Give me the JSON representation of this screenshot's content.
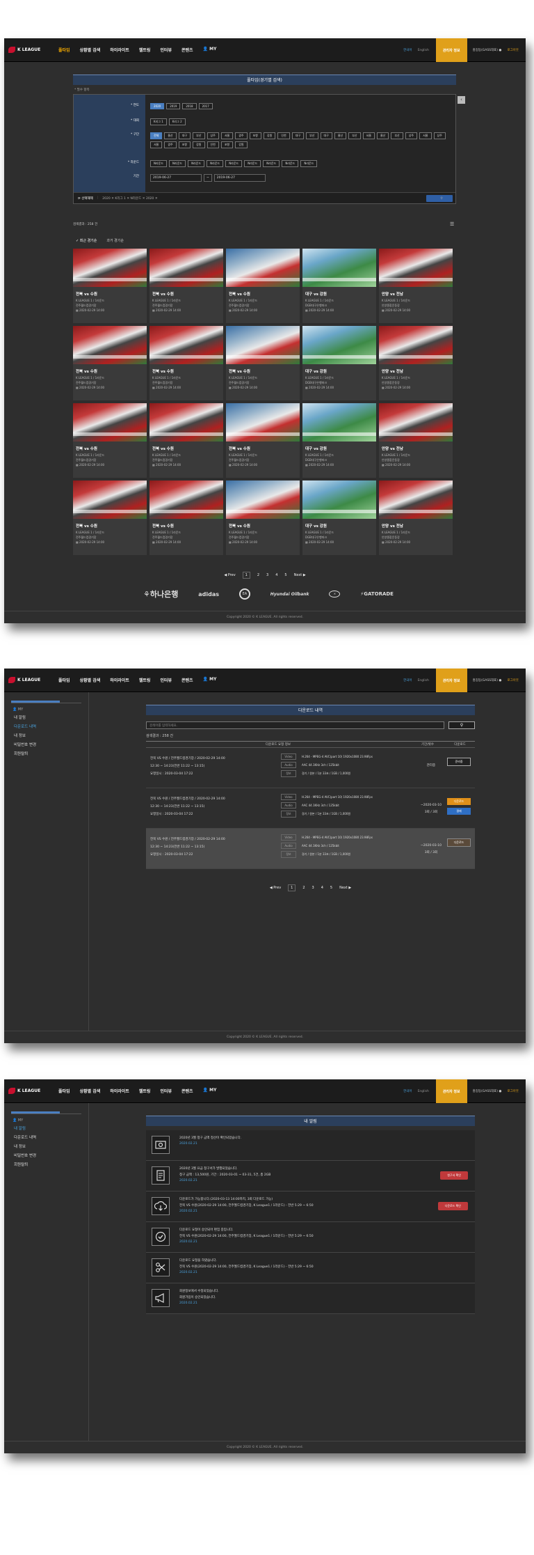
{
  "nav": {
    "logo": "K LEAGUE",
    "menu": [
      "풀타임",
      "상황별 검색",
      "하이라이트",
      "챌트링",
      "인터뷰",
      "콘텐츠",
      "MY"
    ],
    "lang_ko": "한국어",
    "lang_en": "English",
    "vip": "관리자 정보",
    "user": "홍길동(GASS대표) ●",
    "logout": "로그아웃"
  },
  "search": {
    "title": "풀타임(경기별 검색)",
    "required": "* 필수 항목",
    "season_label": "* 연도",
    "seasons": [
      "2020",
      "2019",
      "2018",
      "2017"
    ],
    "league_label": "* 대회",
    "leagues": [
      "K리그 1",
      "K리그 2"
    ],
    "club_label": "* 구단",
    "clubs": [
      "전체",
      "울산",
      "대구",
      "부산",
      "상주",
      "서울",
      "광주",
      "포항",
      "강원",
      "인천",
      "대구",
      "부산",
      "대구",
      "울산",
      "부산",
      "서울",
      "울산",
      "부산",
      "상주",
      "서울",
      "상주",
      "서울",
      "광주",
      "포항",
      "강원",
      "인천",
      "포항",
      "강원"
    ],
    "round_label": "* 라운드",
    "rounds": [
      "N라운드",
      "N라운드",
      "N라운드",
      "N라운드",
      "N라운드",
      "N라운드",
      "N라운드",
      "N라운드",
      "N라운드"
    ],
    "period_label": "기간",
    "date_from": "2019-06-27",
    "tilde": "~",
    "date_to": "2019-06-27",
    "reset": "⟳ 선택해제",
    "selected": "2020 ✕   K리그 1 ✕   N라운드 ✕   2020 ✕",
    "button_icon": "search-icon"
  },
  "results": {
    "count": "검색결과 : 258 건",
    "tab_recent": "✓ 최근 경기순",
    "tab_past": "과거 경기순",
    "cards": [
      {
        "title": "전북 vs 수원",
        "league": "K LEAGUE 1 / 1라운드",
        "venue": "전주월드컵경기장",
        "date": "▦ 2020-02-29 14:00",
        "thumb": "t1"
      },
      {
        "title": "전북 vs 수원",
        "league": "K LEAGUE 1 / 1라운드",
        "venue": "전주월드컵경기장",
        "date": "▦ 2020-02-29 14:00",
        "thumb": "t1"
      },
      {
        "title": "전북 vs 수원",
        "league": "K LEAGUE 1 / 1라운드",
        "venue": "전주월드컵경기장",
        "date": "▦ 2020-02-29 14:00",
        "thumb": "t2"
      },
      {
        "title": "대구 vs 강원",
        "league": "K LEAGUE 1 / 1라운드",
        "venue": "DGB대구은행파크",
        "date": "▦ 2020-02-29 14:00",
        "thumb": "t3"
      },
      {
        "title": "안양 vs 전남",
        "league": "K LEAGUE 1 / 1라운드",
        "venue": "안양종합운동장",
        "date": "▦ 2020-02-29 14:00",
        "thumb": "t1"
      },
      {
        "title": "전북 vs 수원",
        "league": "K LEAGUE 1 / 1라운드",
        "venue": "전주월드컵경기장",
        "date": "▦ 2020-02-29 14:00",
        "thumb": "t1"
      },
      {
        "title": "전북 vs 수원",
        "league": "K LEAGUE 1 / 1라운드",
        "venue": "전주월드컵경기장",
        "date": "▦ 2020-02-29 14:00",
        "thumb": "t1"
      },
      {
        "title": "전북 vs 수원",
        "league": "K LEAGUE 1 / 1라운드",
        "venue": "전주월드컵경기장",
        "date": "▦ 2020-02-29 14:00",
        "thumb": "t2"
      },
      {
        "title": "대구 vs 강원",
        "league": "K LEAGUE 1 / 1라운드",
        "venue": "DGB대구은행파크",
        "date": "▦ 2020-02-29 14:00",
        "thumb": "t3"
      },
      {
        "title": "안양 vs 전남",
        "league": "K LEAGUE 1 / 1라운드",
        "venue": "안양종합운동장",
        "date": "▦ 2020-02-29 14:00",
        "thumb": "t1"
      },
      {
        "title": "전북 vs 수원",
        "league": "K LEAGUE 1 / 1라운드",
        "venue": "전주월드컵경기장",
        "date": "▦ 2020-02-29 14:00",
        "thumb": "t1"
      },
      {
        "title": "전북 vs 수원",
        "league": "K LEAGUE 1 / 1라운드",
        "venue": "전주월드컵경기장",
        "date": "▦ 2020-02-29 14:00",
        "thumb": "t1"
      },
      {
        "title": "전북 vs 수원",
        "league": "K LEAGUE 1 / 1라운드",
        "venue": "전주월드컵경기장",
        "date": "▦ 2020-02-29 14:00",
        "thumb": "t2"
      },
      {
        "title": "대구 vs 강원",
        "league": "K LEAGUE 1 / 1라운드",
        "venue": "DGB대구은행파크",
        "date": "▦ 2020-02-29 14:00",
        "thumb": "t3"
      },
      {
        "title": "안양 vs 전남",
        "league": "K LEAGUE 1 / 1라운드",
        "venue": "안양종합운동장",
        "date": "▦ 2020-02-29 14:00",
        "thumb": "t1"
      },
      {
        "title": "전북 vs 수원",
        "league": "K LEAGUE 1 / 1라운드",
        "venue": "전주월드컵경기장",
        "date": "▦ 2020-02-29 14:00",
        "thumb": "t1"
      },
      {
        "title": "전북 vs 수원",
        "league": "K LEAGUE 1 / 1라운드",
        "venue": "전주월드컵경기장",
        "date": "▦ 2020-02-29 14:00",
        "thumb": "t1"
      },
      {
        "title": "전북 vs 수원",
        "league": "K LEAGUE 1 / 1라운드",
        "venue": "전주월드컵경기장",
        "date": "▦ 2020-02-29 14:00",
        "thumb": "t2"
      },
      {
        "title": "대구 vs 강원",
        "league": "K LEAGUE 1 / 1라운드",
        "venue": "DGB대구은행파크",
        "date": "▦ 2020-02-29 14:00",
        "thumb": "t3"
      },
      {
        "title": "안양 vs 전남",
        "league": "K LEAGUE 1 / 1라운드",
        "venue": "안양종합운동장",
        "date": "▦ 2020-02-29 14:00",
        "thumb": "t1"
      }
    ]
  },
  "pager": {
    "prev": "◀ Prev",
    "pages": [
      "1",
      "2",
      "3",
      "4",
      "5"
    ],
    "next": "Next ▶"
  },
  "sponsors": {
    "hana": "하나은행",
    "adidas": "adidas",
    "ea": "EA",
    "hyundai": "Hyundai Oilbank",
    "gatorade": "GATORADE"
  },
  "footer": "Copyright 2020 © K LEAGUE. All rights reserved.",
  "side": {
    "title": "MY",
    "items": [
      "내 알림",
      "다운로드 내역",
      "내 정보",
      "비밀번호 변경",
      "회원탈퇴"
    ]
  },
  "downloads": {
    "title": "다운로드 내역",
    "placeholder": "검색어를 입력하세요.",
    "count": "검색결과 : 258 건",
    "col_info": "다운로드 요청 정보",
    "col_period": "기간/횟수",
    "col_action": "다운로드",
    "rows": [
      {
        "match": "전북 VS 수원 / 전주월드컵경기장 / 2020-02-29 14:00",
        "time": "12:30 ~ 14:23(전반 11:22 ~ 13:15)",
        "req": "요청일시 : 2020-03-04 17:22",
        "video": "H.264 - MPEG-4 AVC(part 10) 1920x1080 23.98Fps",
        "audio": "AAC 44.1KHz 3ch / 125kbit",
        "etc": "경기 / 원본 / 1분 33초 / 1GB / 1,000원",
        "period": "관리중",
        "period2": "",
        "btn1": "준비중",
        "btn2": ""
      },
      {
        "match": "전북 VS 수원 / 전주월드컵경기장 / 2020-02-29 14:00",
        "time": "12:30 ~ 14:23(전반 11:22 ~ 13:15)",
        "req": "요청일시 : 2020-03-04 17:22",
        "video": "H.264 - MPEG-4 AVC(part 10) 1920x1080 23.98Fps",
        "audio": "AAC 44.1KHz 3ch / 125kbit",
        "etc": "경기 / 원본 / 1분 33초 / 1GB / 1,000원",
        "period": "~2020-03-10",
        "period2": "3회 / 3회",
        "btn1": "다운로드",
        "btn2": "결제"
      },
      {
        "match": "전북 VS 수원 / 전주월드컵경기장 / 2020-02-29 14:00",
        "time": "12:30 ~ 14:23(전반 11:22 ~ 13:15)",
        "req": "요청일시 : 2020-03-04 17:22",
        "video": "H.264 - MPEG-4 AVC(part 10) 1920x1080 23.98Fps",
        "audio": "AAC 44.1KHz 3ch / 125kbit",
        "etc": "경기 / 원본 / 1분 33초 / 1GB / 1,000원",
        "period": "~2020-03-10",
        "period2": "3회 / 3회",
        "btn1": "다운로드",
        "btn2": ""
      }
    ],
    "tag_video": "Video",
    "tag_audio": "Audio",
    "tag_etc": "정보"
  },
  "alerts": {
    "title": "내 알림",
    "rows": [
      {
        "icon": "money-icon",
        "line1": "2020년 3월 청구 금액 정산이 확인되었습니다.",
        "line2": "",
        "date": "2020.02.21",
        "button": ""
      },
      {
        "icon": "invoice-icon",
        "line1": "2020년 3월 요금 청구서가 발행되었습니다.",
        "line2": "청구 금액 : 13,500원, 기간 : 2020-03-01 ~ 03-31, 5건, 총 2GB",
        "date": "2020.02.21",
        "button": "청구서 확인"
      },
      {
        "icon": "cloud-download-icon",
        "line1": "다운로드가 가능합니다.(2020-03-13 14:00까지, 3회 다운로드 가능)",
        "line2": "전북 VS 수원(2020-02-29 14:00, 전주월드컵경기장, K League1 / 1라운드) - 전반 5:29 ~ 6:50",
        "date": "2020.02.21",
        "button": "다운로드 확인"
      },
      {
        "icon": "check-icon",
        "line1": "다운로드 요청이 승인되어 편집 중입니다.",
        "line2": "전북 VS 수원(2020-02-29 14:00, 전주월드컵경기장, K League1 / 1라운드) - 전반 5:29 ~ 6:50",
        "date": "2020.02.21",
        "button": ""
      },
      {
        "icon": "scissors-icon",
        "line1": "다운로드 요청을 하였습니다.",
        "line2": "전북 VS 수원(2020-02-29 14:00, 전주월드컵경기장, K League1 / 1라운드) - 전반 5:29 ~ 6:50",
        "date": "2020.02.21",
        "button": ""
      },
      {
        "icon": "megaphone-icon",
        "line1": "회원정보에서 수정되었습니다.",
        "line2": "회원가입이 승인되었습니다.",
        "date": "2020.02.21",
        "button": ""
      }
    ]
  }
}
